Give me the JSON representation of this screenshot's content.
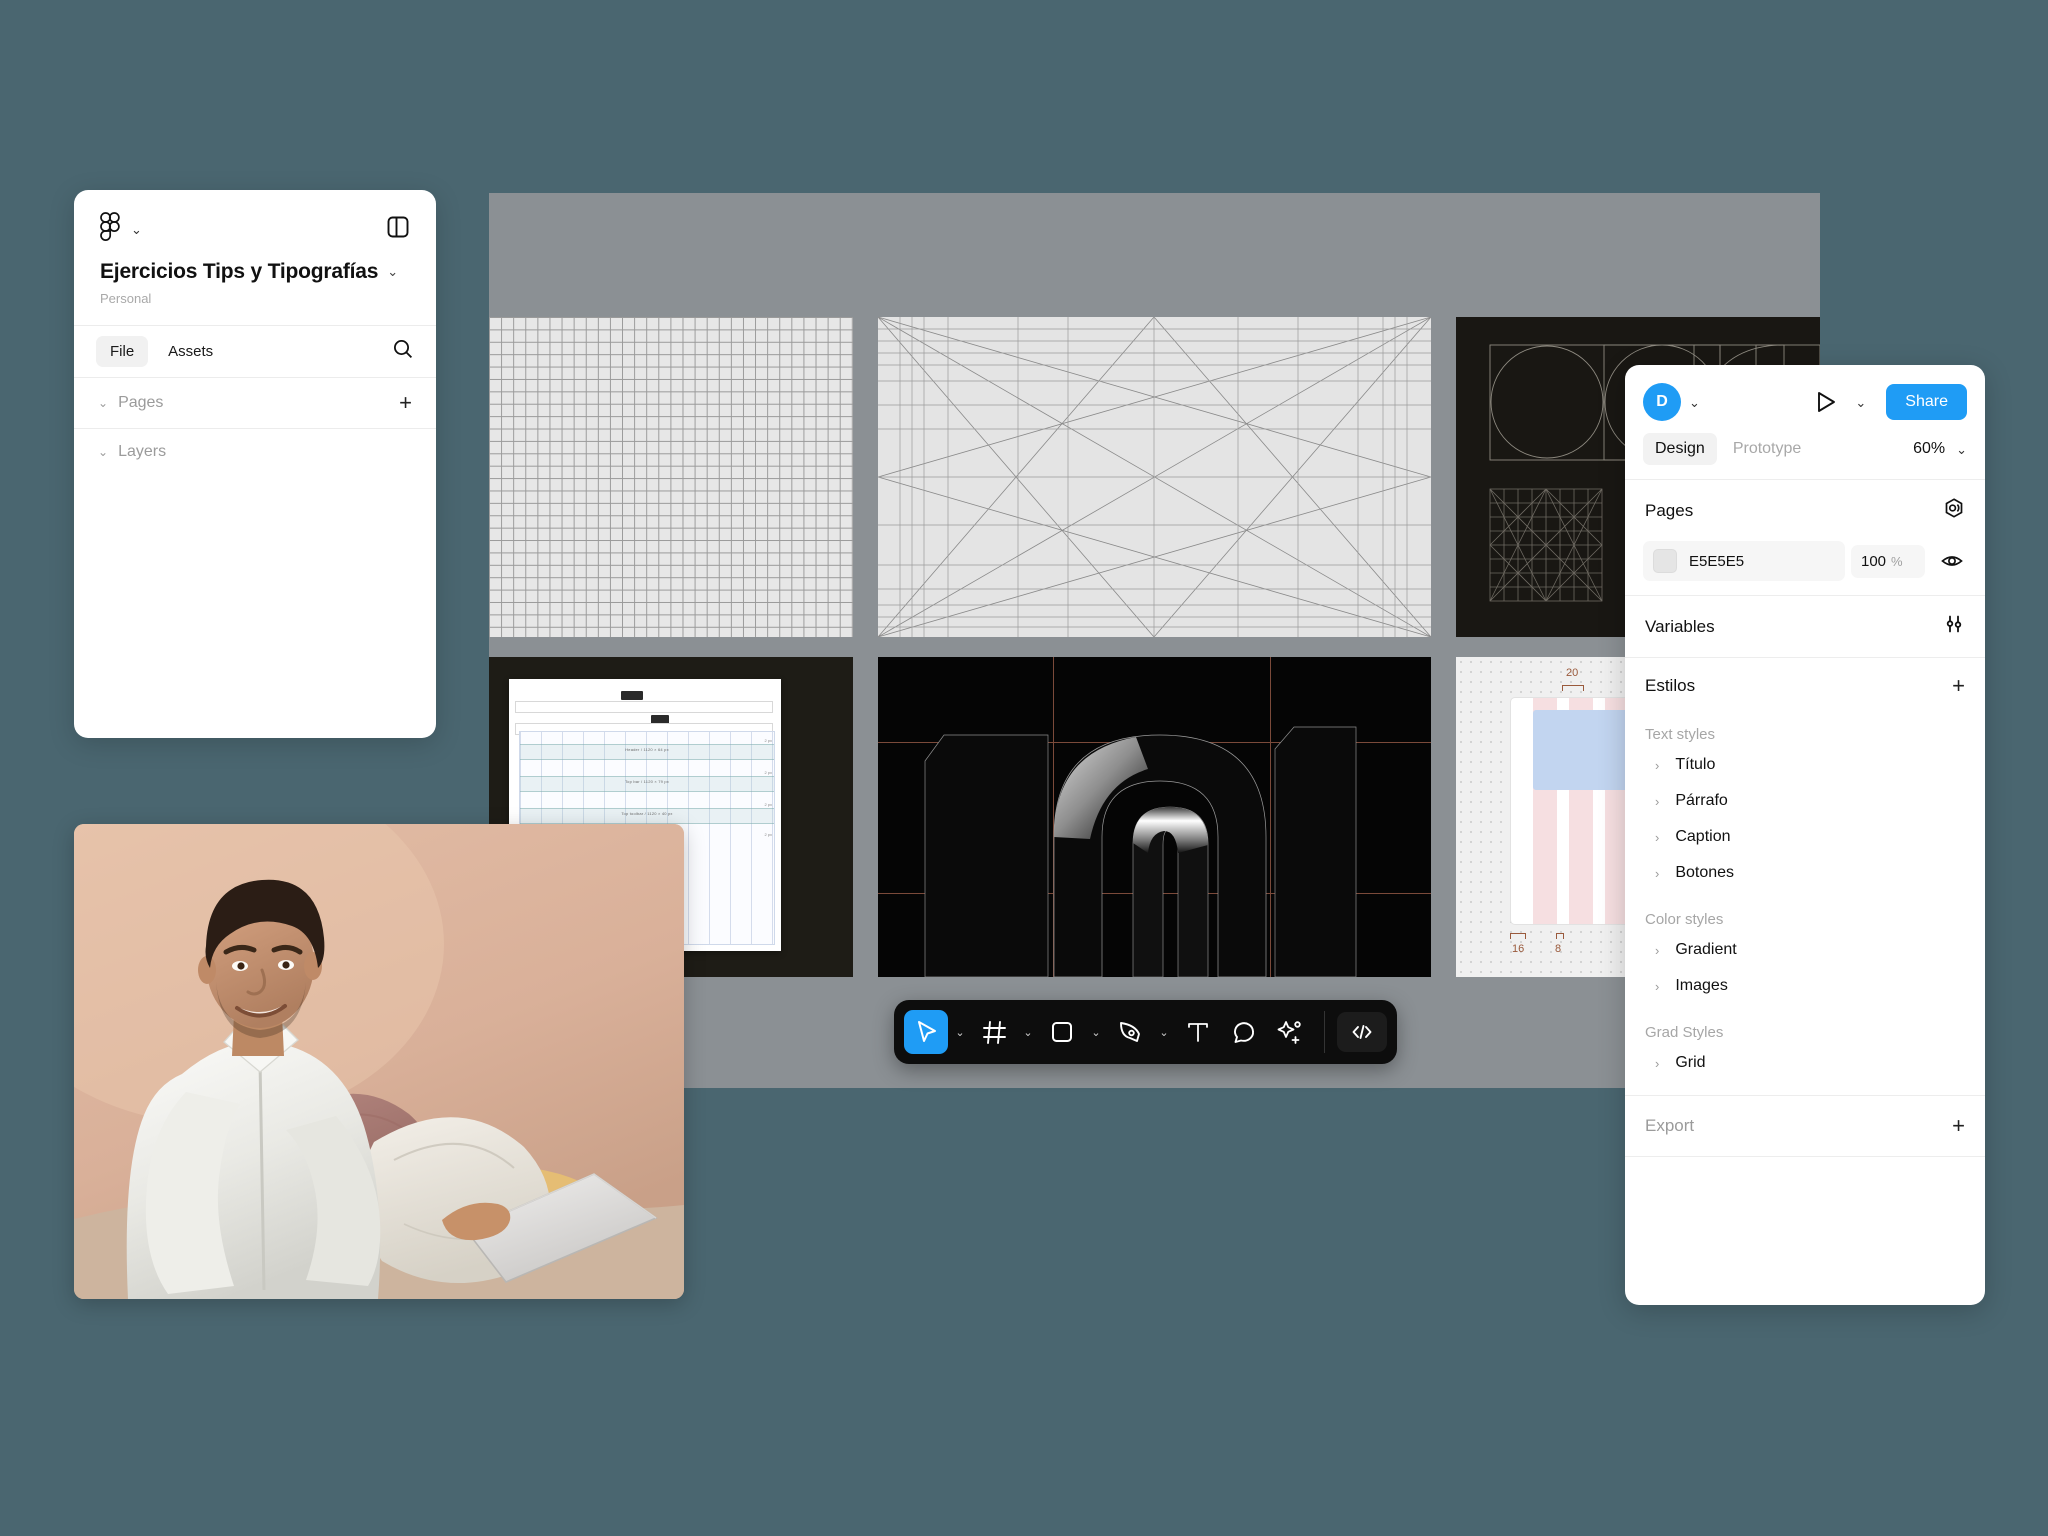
{
  "app": {
    "accent_color": "#1F9CF5",
    "canvas_bg": "#8B9094",
    "desktop_bg": "#4A6670"
  },
  "left_panel": {
    "logo_icon": "figma-logo-icon",
    "logo_chevron": "⌄",
    "layout_toggle_icon": "panel-layout-icon",
    "file_title": "Ejercicios Tips y Tipografías",
    "title_chevron": "⌄",
    "subtitle": "Personal",
    "tabs": [
      {
        "label": "File",
        "active": true
      },
      {
        "label": "Assets",
        "active": false
      }
    ],
    "search_icon": "search-icon",
    "sections": [
      {
        "label": "Pages",
        "chevron": "⌄",
        "action": "+"
      },
      {
        "label": "Layers",
        "chevron": "⌄",
        "action": ""
      }
    ]
  },
  "right_panel": {
    "avatar_initial": "D",
    "avatar_chevron": "⌄",
    "play_icon": "play-icon",
    "play_chevron": "⌄",
    "share_label": "Share",
    "tabs": [
      {
        "label": "Design",
        "active": true
      },
      {
        "label": "Prototype",
        "active": false
      }
    ],
    "zoom_level": "60%",
    "zoom_chevron": "⌄",
    "pages": {
      "title": "Pages",
      "icon": "page-settings-icon",
      "swatch_hex": "E5E5E5",
      "swatch_color": "#E5E5E5",
      "opacity_value": "100",
      "opacity_unit": "%",
      "visibility_icon": "eye-icon"
    },
    "variables": {
      "title": "Variables",
      "icon": "sliders-icon"
    },
    "estilos": {
      "title": "Estilos",
      "add_action": "+",
      "groups": [
        {
          "label": "Text styles",
          "items": [
            {
              "label": "Título",
              "chevron": "›"
            },
            {
              "label": "Párrafo",
              "chevron": "›"
            },
            {
              "label": "Caption",
              "chevron": "›"
            },
            {
              "label": "Botones",
              "chevron": "›"
            }
          ]
        },
        {
          "label": "Color styles",
          "items": [
            {
              "label": "Gradient",
              "chevron": "›"
            },
            {
              "label": "Images",
              "chevron": "›"
            }
          ]
        },
        {
          "label": "Grad Styles",
          "items": [
            {
              "label": "Grid",
              "chevron": "›"
            }
          ]
        }
      ]
    },
    "export": {
      "title": "Export",
      "add_action": "+"
    }
  },
  "toolbar": {
    "items": [
      {
        "icon": "cursor-select-icon",
        "active": true,
        "has_chevron": true
      },
      {
        "icon": "frame-grid-icon",
        "active": false,
        "has_chevron": true
      },
      {
        "icon": "rectangle-shape-icon",
        "active": false,
        "has_chevron": true
      },
      {
        "icon": "pen-tool-icon",
        "active": false,
        "has_chevron": true
      },
      {
        "icon": "text-tool-icon",
        "active": false,
        "has_chevron": false
      },
      {
        "icon": "comment-bubble-icon",
        "active": false,
        "has_chevron": false
      },
      {
        "icon": "ai-sparkle-icon",
        "active": false,
        "has_chevron": false
      }
    ],
    "code_icon": "code-brackets-icon",
    "code_label": "‹/›",
    "chevron_glyph": "⌄"
  },
  "canvas": {
    "thumbnails": [
      {
        "name": "fine-baseline-grid",
        "kind": "light-grid"
      },
      {
        "name": "diagonal-construction-grid",
        "kind": "light-grid"
      },
      {
        "name": "golden-ratio-dark-card",
        "kind": "dark-diagram"
      },
      {
        "name": "layout-spec-document",
        "kind": "document"
      },
      {
        "name": "3d-typography-render",
        "kind": "dark-photo"
      },
      {
        "name": "spacing-grid-spec",
        "kind": "spacing"
      }
    ],
    "spacing_labels": {
      "top": "20",
      "bottom_left": "16",
      "bottom_right": "8",
      "color": "#9A5A3C"
    },
    "document_rows": [
      "Header / 1120 × 64 px",
      "Top bar / 1120 × 79 px",
      "Top toolbar / 1120 × 40 px"
    ]
  },
  "photo": {
    "name": "man-with-laptop-on-sofa",
    "alt": "Smiling man in white shirt sitting on a sofa with a laptop"
  }
}
